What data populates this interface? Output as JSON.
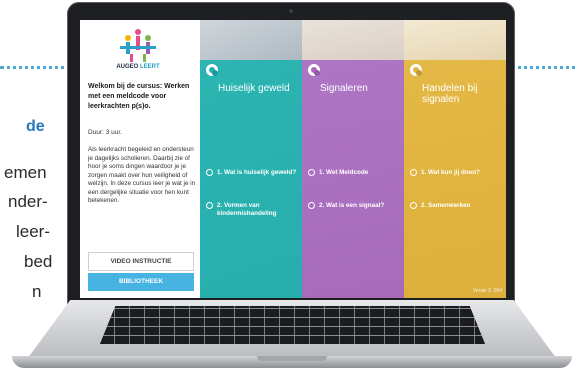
{
  "background": {
    "heading": "de",
    "lines": [
      "emen",
      "nder-",
      "leer-",
      "bed",
      "n"
    ]
  },
  "app": {
    "logo": {
      "part1": "AUGEO",
      "part2": "LEERT"
    },
    "welcome": "Welkom bij de cursus: Werken met een meldcode voor leerkrachten p(s)o.",
    "duration": "Duur: 3 uur.",
    "description": "Als leerkracht begeleid en ondersteun je dagelijks scholieren. Daarbij zie of hoor je soms dingen waardoor je je zorgen maakt over hun veiligheid of welzijn. In deze cursus leer je wat je in een dergelijke situatie voor hen kunt betekenen.",
    "buttons": {
      "video": "VIDEO INSTRUCTIE",
      "library": "BIBLIOTHEEK"
    },
    "columns": [
      {
        "title": "Huiselijk geweld",
        "color": "#21b3b0",
        "items": [
          "1. Wat is huiselijk geweld?",
          "2. Vormen van kindermishandeling"
        ]
      },
      {
        "title": "Signaleren",
        "color": "#a86ac4",
        "items": [
          "1. Wet Meldcode",
          "2. Wat is een signaal?"
        ]
      },
      {
        "title": "Handelen bij signalen",
        "color": "#e3b53a",
        "items": [
          "1. Wat kun jij doen?",
          "2. Samenwerken"
        ]
      }
    ],
    "version": "Versie 2. 004"
  },
  "colors": {
    "accent_blue": "#46b3e3",
    "dots": "#4fa9d6"
  }
}
